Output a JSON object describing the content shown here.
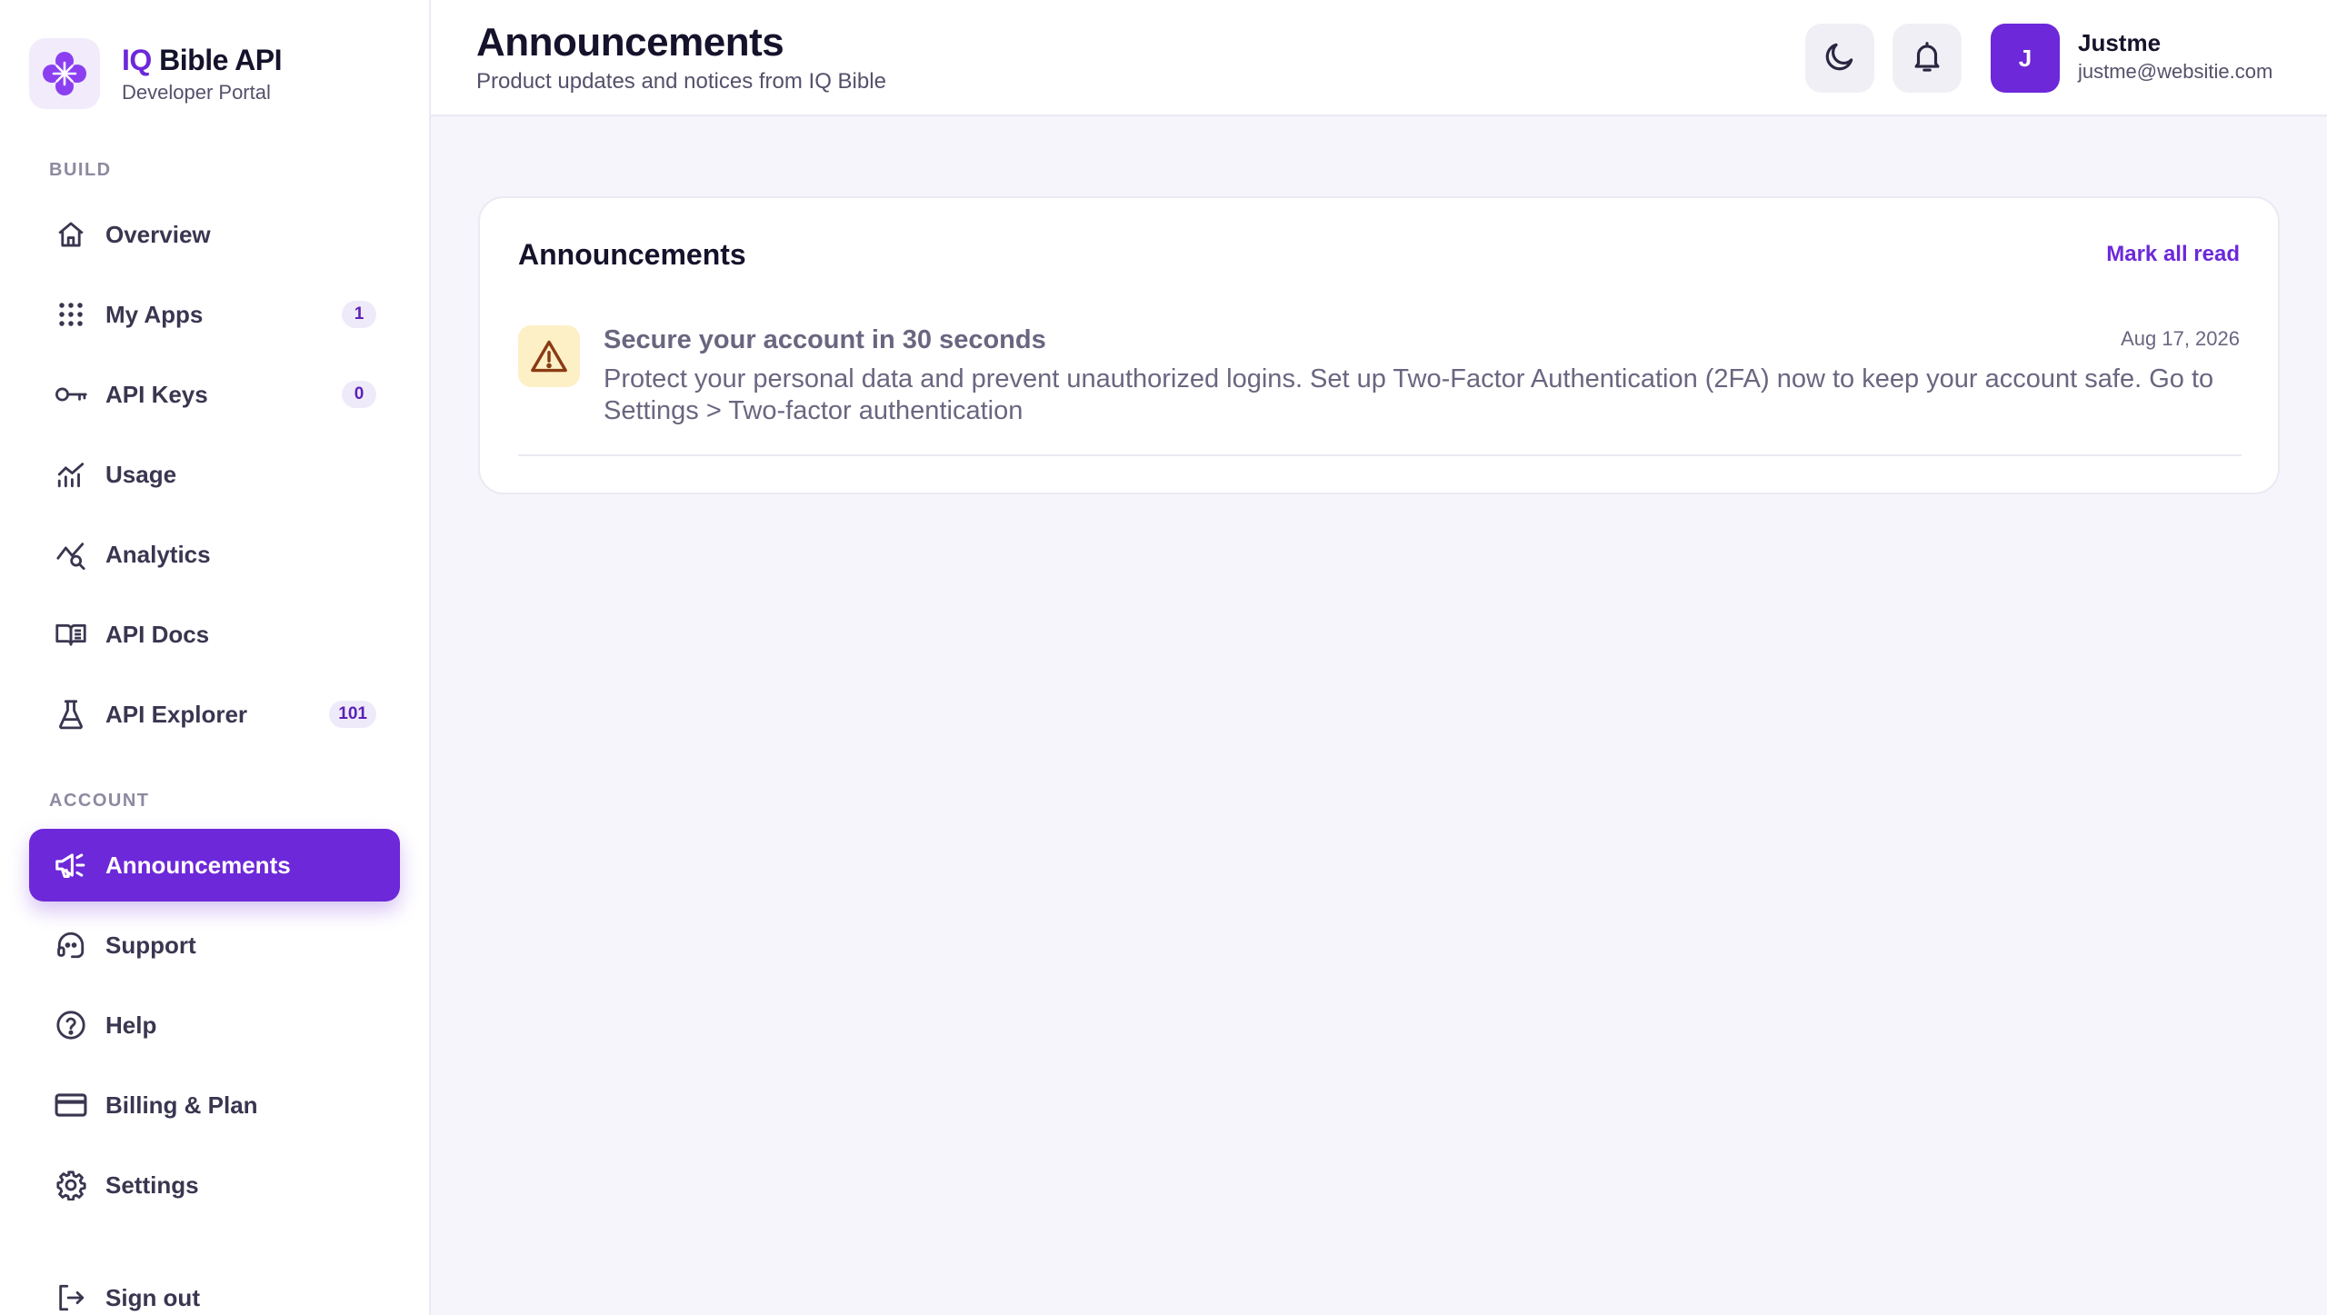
{
  "brand": {
    "title_accent": "IQ",
    "title_rest": " Bible API",
    "subtitle": "Developer Portal"
  },
  "sidebar": {
    "build_label": "BUILD",
    "account_label": "ACCOUNT",
    "build_items": [
      {
        "label": "Overview",
        "icon": "home-icon"
      },
      {
        "label": "My Apps",
        "icon": "grid-dots-icon",
        "badge": "1"
      },
      {
        "label": "API Keys",
        "icon": "key-icon",
        "badge": "0"
      },
      {
        "label": "Usage",
        "icon": "bar-chart-icon"
      },
      {
        "label": "Analytics",
        "icon": "analytics-search-icon"
      },
      {
        "label": "API Docs",
        "icon": "book-icon"
      },
      {
        "label": "API Explorer",
        "icon": "flask-icon",
        "badge": "101"
      }
    ],
    "account_items": [
      {
        "label": "Announcements",
        "icon": "megaphone-icon",
        "active": true
      },
      {
        "label": "Support",
        "icon": "headset-icon"
      },
      {
        "label": "Help",
        "icon": "help-circle-icon"
      },
      {
        "label": "Billing & Plan",
        "icon": "credit-card-icon"
      },
      {
        "label": "Settings",
        "icon": "gear-icon"
      }
    ],
    "sign_out": "Sign out"
  },
  "header": {
    "title": "Announcements",
    "subtitle": "Product updates and notices from IQ Bible",
    "user": {
      "initial": "J",
      "name": "Justme",
      "email": "justme@websitie.com"
    }
  },
  "announcements": {
    "title": "Announcements",
    "mark_all_read": "Mark all read",
    "items": [
      {
        "icon": "warning-icon",
        "title": "Secure your account in 30 seconds",
        "date": "Aug 17, 2026",
        "body": "Protect your personal data and prevent unauthorized logins. Set up Two-Factor Authentication (2FA) now to keep your account safe. Go to Settings > Two-factor authentication"
      }
    ]
  },
  "colors": {
    "accent": "#6d28d9",
    "warning_bg": "#fdf0c7",
    "warning_fg": "#8a3b12"
  }
}
